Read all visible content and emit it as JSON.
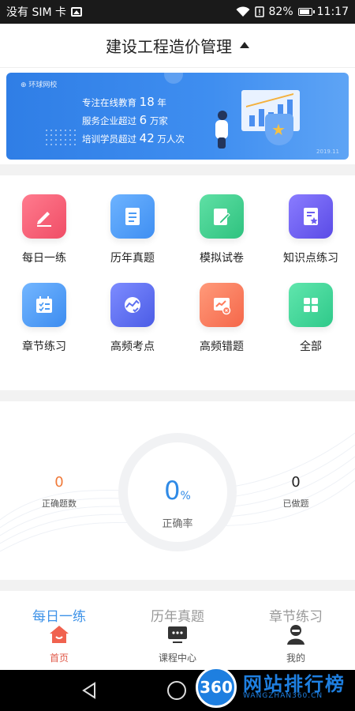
{
  "status_bar": {
    "carrier": "没有 SIM 卡",
    "battery": "82%",
    "time": "11:17"
  },
  "header": {
    "title": "建设工程造价管理"
  },
  "banner": {
    "brand": "环球网校",
    "line1_prefix": "专注在线教育",
    "line1_num": "18",
    "line1_suffix": "年",
    "line2_prefix": "服务企业超过",
    "line2_num": "6",
    "line2_suffix": "万家",
    "line3_prefix": "培训学员超过",
    "line3_num": "42",
    "line3_suffix": "万人次",
    "small": "2019.11"
  },
  "grid": {
    "items": [
      {
        "label": "每日一练",
        "icon": "pencil-icon",
        "color": "#f25a70"
      },
      {
        "label": "历年真题",
        "icon": "document-icon",
        "color": "#4c9cf5"
      },
      {
        "label": "模拟试卷",
        "icon": "edit-paper-icon",
        "color": "#3dcc8a"
      },
      {
        "label": "知识点练习",
        "icon": "star-document-icon",
        "color": "#6b5ef0"
      },
      {
        "label": "章节练习",
        "icon": "checklist-icon",
        "color": "#4a9af5"
      },
      {
        "label": "高频考点",
        "icon": "chart-check-icon",
        "color": "#5c6ff0"
      },
      {
        "label": "高频错题",
        "icon": "chart-error-icon",
        "color": "#ff7a5a"
      },
      {
        "label": "全部",
        "icon": "grid-icon",
        "color": "#3fd69a"
      }
    ]
  },
  "stats": {
    "correct_count": "0",
    "correct_count_label": "正确题数",
    "accuracy": "0",
    "accuracy_unit": "%",
    "accuracy_label": "正确率",
    "done_count": "0",
    "done_count_label": "已做题"
  },
  "subtabs": [
    "每日一练",
    "历年真题",
    "章节练习"
  ],
  "nav": [
    {
      "label": "首页",
      "icon": "home-icon"
    },
    {
      "label": "课程中心",
      "icon": "course-icon"
    },
    {
      "label": "我的",
      "icon": "profile-icon"
    }
  ],
  "watermark": {
    "badge": "360",
    "name": "网站排行榜",
    "url": "WANGZHAN360.CN"
  },
  "colors": {
    "accent": "#3d92e8",
    "nav_active": "#e05a4a",
    "banner": "#3f8ef0"
  }
}
